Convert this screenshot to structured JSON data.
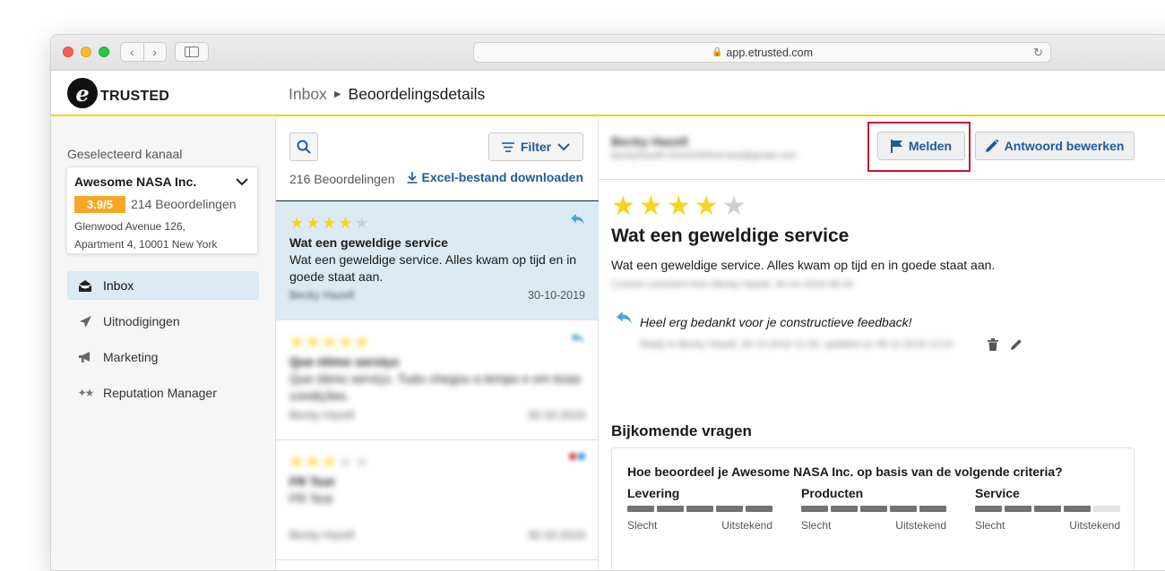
{
  "browser": {
    "url": "app.etrusted.com"
  },
  "header": {
    "logo_text": "TRUSTED",
    "logo_letter": "e",
    "breadcrumb": [
      "Inbox",
      "Beoordelingsdetails"
    ]
  },
  "sidebar": {
    "channel_label": "Geselecteerd kanaal",
    "channel": {
      "name": "Awesome NASA Inc.",
      "rating": "3.9/5",
      "review_count": "214 Beoordelingen",
      "address_line1": "Glenwood Avenue 126,",
      "address_line2": "Apartment 4, 10001 New York"
    },
    "nav": [
      {
        "label": "Inbox",
        "icon": "inbox-icon",
        "active": true
      },
      {
        "label": "Uitnodigingen",
        "icon": "paper-plane-icon"
      },
      {
        "label": "Marketing",
        "icon": "megaphone-icon"
      },
      {
        "label": "Reputation Manager",
        "icon": "sparkle-stars-icon"
      }
    ]
  },
  "list": {
    "filter_label": "Filter",
    "count_label": "216 Beoordelingen",
    "download_label": "Excel-bestand downloaden",
    "reviews": [
      {
        "stars": 4,
        "title": "Wat een geweldige service",
        "body": "Wat een geweldige service. Alles kwam op tijd en in goede staat aan.",
        "author": "Becky Hazell",
        "date": "30-10-2019",
        "selected": true
      },
      {
        "stars": 5,
        "title": "Que ótimo serviço",
        "body": "Que ótimo serviço. Tudo chegou a tempo e em boas condições.",
        "author": "Becky Hazell",
        "date": "30-10-2019"
      },
      {
        "stars": 3,
        "title": "FR Test",
        "body": "FR Test",
        "author": "Becky Hazell",
        "date": "30-10-2019"
      }
    ]
  },
  "detail": {
    "author": "Becky Hazell",
    "email": "beckyhazell+2019150618.test@gmail.com",
    "report_label": "Melden",
    "edit_reply_label": "Antwoord bewerken",
    "stars": 4,
    "title": "Wat een geweldige service",
    "body": "Wat een geweldige service. Alles kwam op tijd en in goede staat aan.",
    "meta": "Current comment from Becky Hazell, 30-10-2019 08:16",
    "reply": "Heel erg bedankt voor je constructieve feedback!",
    "reply_meta": "Reply to Becky Hazell, 30-10-2019 11:26, updated on 08-11-2019 13:23",
    "additional_heading": "Bijkomende vragen",
    "question": "Hoe beoordeel je Awesome NASA Inc. op basis van de volgende criteria?",
    "criteria": [
      {
        "name": "Levering",
        "score": 5,
        "max": 5,
        "low": "Slecht",
        "high": "Uitstekend"
      },
      {
        "name": "Producten",
        "score": 5,
        "max": 5,
        "low": "Slecht",
        "high": "Uitstekend"
      },
      {
        "name": "Service",
        "score": 4,
        "max": 5,
        "low": "Slecht",
        "high": "Uitstekend"
      }
    ]
  },
  "colors": {
    "accent": "#1f5b99",
    "rating_badge": "#f9a825",
    "star": "#f7d420",
    "header_underline": "#f5d21b",
    "highlight_box": "#c8102e",
    "selected_row": "#dbeaf3"
  }
}
